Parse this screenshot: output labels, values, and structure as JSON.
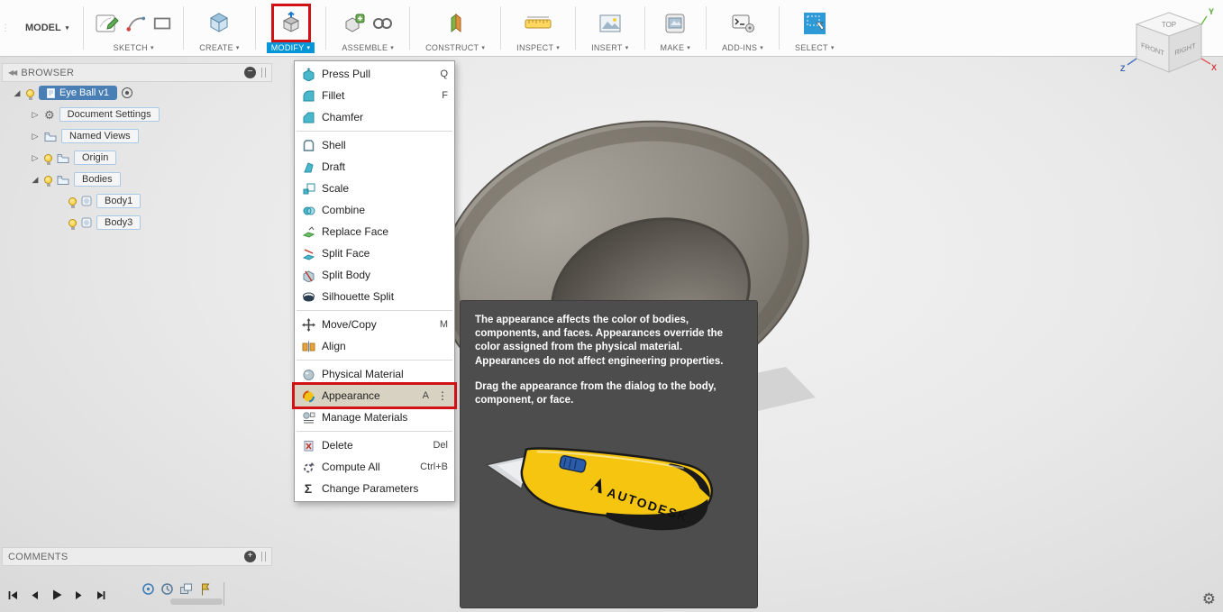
{
  "toolbar": {
    "model": {
      "label": "MODEL"
    },
    "groups": [
      {
        "label": "SKETCH"
      },
      {
        "label": "CREATE"
      },
      {
        "label": "MODIFY"
      },
      {
        "label": "ASSEMBLE"
      },
      {
        "label": "CONSTRUCT"
      },
      {
        "label": "INSPECT"
      },
      {
        "label": "INSERT"
      },
      {
        "label": "MAKE"
      },
      {
        "label": "ADD-INS"
      },
      {
        "label": "SELECT"
      }
    ]
  },
  "browser": {
    "title": "BROWSER",
    "root_label": "Eye Ball v1",
    "items": [
      {
        "label": "Document Settings"
      },
      {
        "label": "Named Views"
      },
      {
        "label": "Origin"
      },
      {
        "label": "Bodies"
      },
      {
        "label": "Body1"
      },
      {
        "label": "Body3"
      }
    ]
  },
  "modify_menu": {
    "items": [
      {
        "label": "Press Pull",
        "shortcut": "Q"
      },
      {
        "label": "Fillet",
        "shortcut": "F"
      },
      {
        "label": "Chamfer",
        "shortcut": ""
      },
      {
        "label": "Shell",
        "shortcut": ""
      },
      {
        "label": "Draft",
        "shortcut": ""
      },
      {
        "label": "Scale",
        "shortcut": ""
      },
      {
        "label": "Combine",
        "shortcut": ""
      },
      {
        "label": "Replace Face",
        "shortcut": ""
      },
      {
        "label": "Split Face",
        "shortcut": ""
      },
      {
        "label": "Split Body",
        "shortcut": ""
      },
      {
        "label": "Silhouette Split",
        "shortcut": ""
      },
      {
        "label": "Move/Copy",
        "shortcut": "M"
      },
      {
        "label": "Align",
        "shortcut": ""
      },
      {
        "label": "Physical Material",
        "shortcut": ""
      },
      {
        "label": "Appearance",
        "shortcut": "A"
      },
      {
        "label": "Manage Materials",
        "shortcut": ""
      },
      {
        "label": "Delete",
        "shortcut": "Del"
      },
      {
        "label": "Compute All",
        "shortcut": "Ctrl+B"
      },
      {
        "label": "Change Parameters",
        "shortcut": ""
      }
    ]
  },
  "tooltip": {
    "para1": "The appearance affects the color of bodies, components, and faces. Appearances override the color assigned from the physical material. Appearances do not affect engineering properties.",
    "para2": "Drag the appearance from the dialog to the body, component, or face.",
    "knife_brand": "AUTODESK"
  },
  "viewcube": {
    "top": "TOP",
    "front": "FRONT",
    "right": "RIGHT",
    "axis_x": "X",
    "axis_y": "Y",
    "axis_z": "Z"
  },
  "comments": {
    "title": "COMMENTS"
  },
  "colors": {
    "accent_blue": "#0696d7",
    "highlight_red": "#d01216",
    "tooltip_bg": "#4d4d4d",
    "menu_highlight": "#d8d2c2",
    "selection_blue": "#4a7fb5"
  }
}
